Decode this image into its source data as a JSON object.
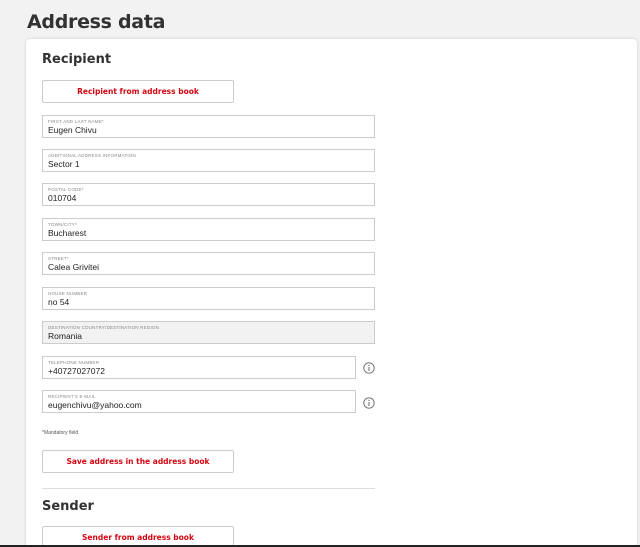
{
  "page": {
    "title": "Address data"
  },
  "recipient": {
    "title": "Recipient",
    "address_book_button": "Recipient from address book",
    "fields": {
      "name": {
        "label": "FIRST AND LAST NAME*",
        "value": "Eugen Chivu"
      },
      "additional": {
        "label": "ADDITIONAL ADDRESS INFORMATION",
        "value": "Sector 1"
      },
      "postal_code": {
        "label": "POSTAL CODE*",
        "value": "010704"
      },
      "city": {
        "label": "TOWN/CITY*",
        "value": "Bucharest"
      },
      "street": {
        "label": "STREET*",
        "value": "Calea Grivitei"
      },
      "house_number": {
        "label": "HOUSE NUMBER",
        "value": "no 54"
      },
      "country": {
        "label": "DESTINATION COUNTRY/DESTINATION REGION",
        "value": "Romania"
      },
      "phone": {
        "label": "TELEPHONE NUMBER",
        "value": "+40727027072"
      },
      "email": {
        "label": "RECIPIENT'S E-MAIL",
        "value": "eugenchivu@yahoo.com"
      }
    },
    "mandatory_hint": "*Mandatory field",
    "save_button": "Save address in the address book"
  },
  "sender": {
    "title": "Sender",
    "address_book_button": "Sender from address book"
  },
  "icons": {
    "info": "info-circle-icon"
  },
  "colors": {
    "accent": "#d40511",
    "border": "#cccccc",
    "background": "#f2f2f2"
  }
}
